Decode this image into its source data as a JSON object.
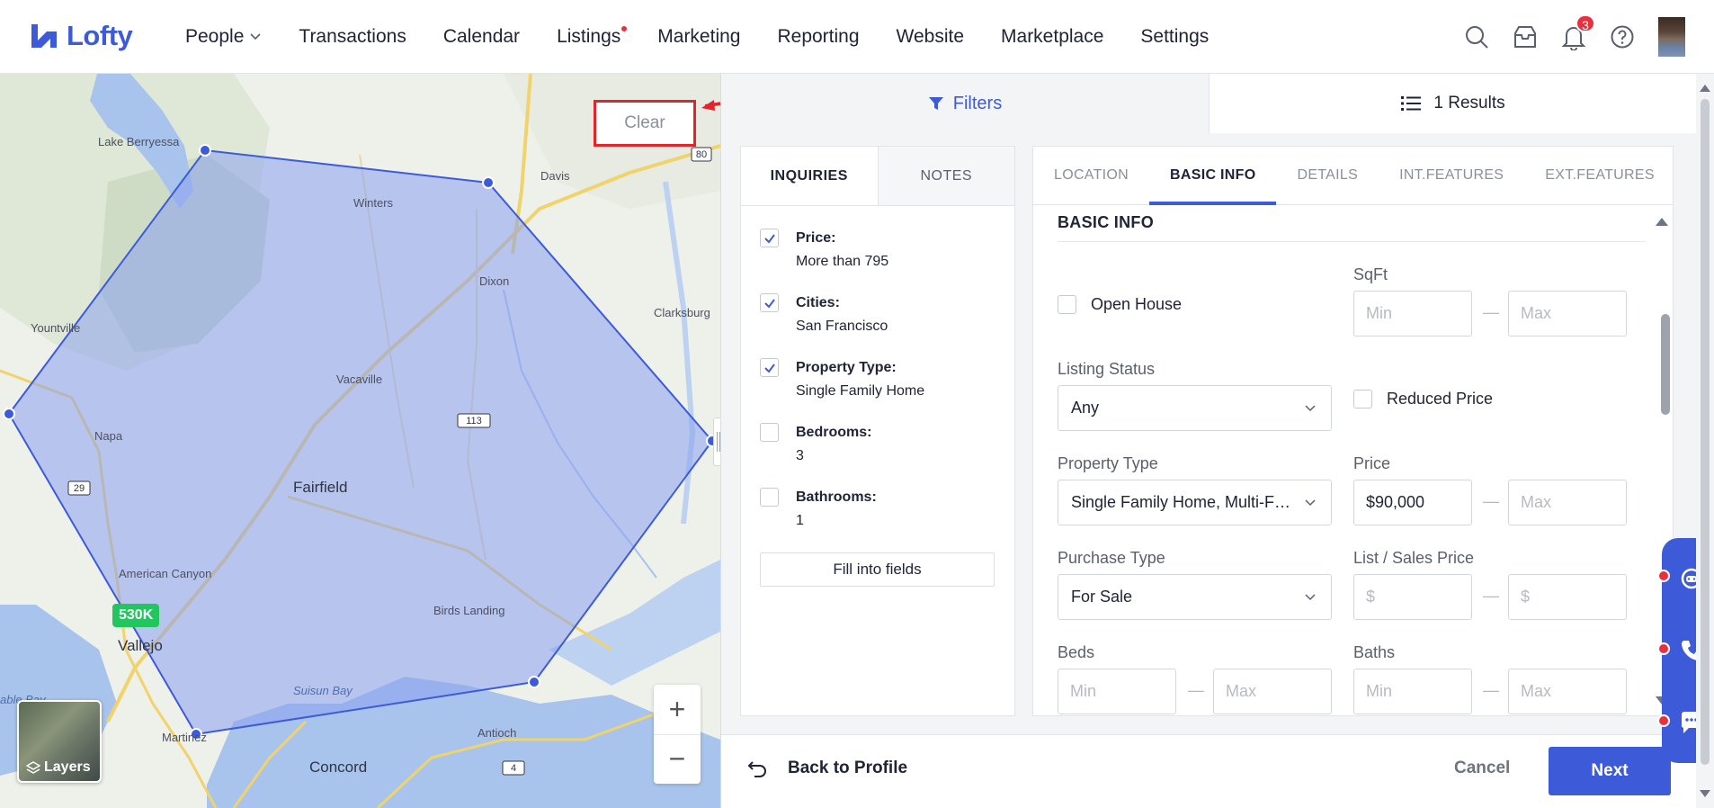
{
  "brand": {
    "name": "Lofty",
    "color": "#3d5bd9"
  },
  "nav": {
    "items": [
      {
        "label": "People",
        "has_dropdown": true
      },
      {
        "label": "Transactions"
      },
      {
        "label": "Calendar"
      },
      {
        "label": "Listings",
        "has_dot": true
      },
      {
        "label": "Marketing"
      },
      {
        "label": "Reporting"
      },
      {
        "label": "Website"
      },
      {
        "label": "Marketplace"
      },
      {
        "label": "Settings"
      }
    ],
    "notification_count": "3",
    "icons": [
      "search-icon",
      "inbox-icon",
      "bell-icon",
      "help-icon"
    ]
  },
  "map": {
    "clear_label": "Clear",
    "price_tag": "530K",
    "layers_label": "Layers",
    "zoom_in": "+",
    "zoom_out": "−",
    "places": {
      "lake_berryessa": "Lake Berryessa",
      "winters": "Winters",
      "davis": "Davis",
      "dixon": "Dixon",
      "clarksburg": "Clarksburg",
      "yountville": "Yountville",
      "vacaville": "Vacaville",
      "napa": "Napa",
      "fairfield": "Fairfield",
      "american_canyon": "American Canyon",
      "vallejo": "Vallejo",
      "birds_landing": "Birds Landing",
      "suisun_bay": "Suisun Bay",
      "martinez": "Martinez",
      "antioch": "Antioch",
      "concord": "Concord",
      "table_bay": "able Bay"
    },
    "routes": {
      "r80": "80",
      "r113": "113",
      "r29": "29",
      "r4": "4"
    }
  },
  "panel": {
    "filters_label": "Filters",
    "results_label": "1 Results",
    "inquiries": {
      "tabs": [
        "INQUIRIES",
        "NOTES"
      ],
      "items": [
        {
          "key": "Price:",
          "value": "More than 795",
          "checked": true
        },
        {
          "key": "Cities:",
          "value": "San Francisco",
          "checked": true
        },
        {
          "key": "Property Type:",
          "value": "Single Family Home",
          "checked": true
        },
        {
          "key": "Bedrooms:",
          "value": "3",
          "checked": false
        },
        {
          "key": "Bathrooms:",
          "value": "1",
          "checked": false
        }
      ],
      "fill_button": "Fill into fields"
    },
    "form": {
      "tabs": [
        "LOCATION",
        "BASIC INFO",
        "DETAILS",
        "INT.FEATURES",
        "EXT.FEATURES"
      ],
      "active_tab": "BASIC INFO",
      "section_title": "BASIC INFO",
      "open_house_label": "Open House",
      "sqft": {
        "label": "SqFt",
        "min_placeholder": "Min",
        "max_placeholder": "Max"
      },
      "listing_status": {
        "label": "Listing Status",
        "value": "Any"
      },
      "reduced_price_label": "Reduced Price",
      "property_type": {
        "label": "Property Type",
        "value": "Single Family Home, Multi-Family"
      },
      "price": {
        "label": "Price",
        "min_value": "$90,000",
        "max_placeholder": "Max"
      },
      "purchase_type": {
        "label": "Purchase Type",
        "value": "For Sale"
      },
      "list_sales_price": {
        "label": "List / Sales Price",
        "min_placeholder": "$",
        "max_placeholder": "$"
      },
      "beds": {
        "label": "Beds",
        "min_placeholder": "Min",
        "max_placeholder": "Max"
      },
      "baths": {
        "label": "Baths",
        "min_placeholder": "Min",
        "max_placeholder": "Max"
      },
      "range_separator": "—"
    },
    "footer": {
      "back_label": "Back to Profile",
      "cancel_label": "Cancel",
      "next_label": "Next"
    }
  },
  "colors": {
    "accent": "#3d5bd9",
    "danger": "#e8303f",
    "polygon_fill": "#8aa0f0",
    "success": "#22c55e"
  }
}
